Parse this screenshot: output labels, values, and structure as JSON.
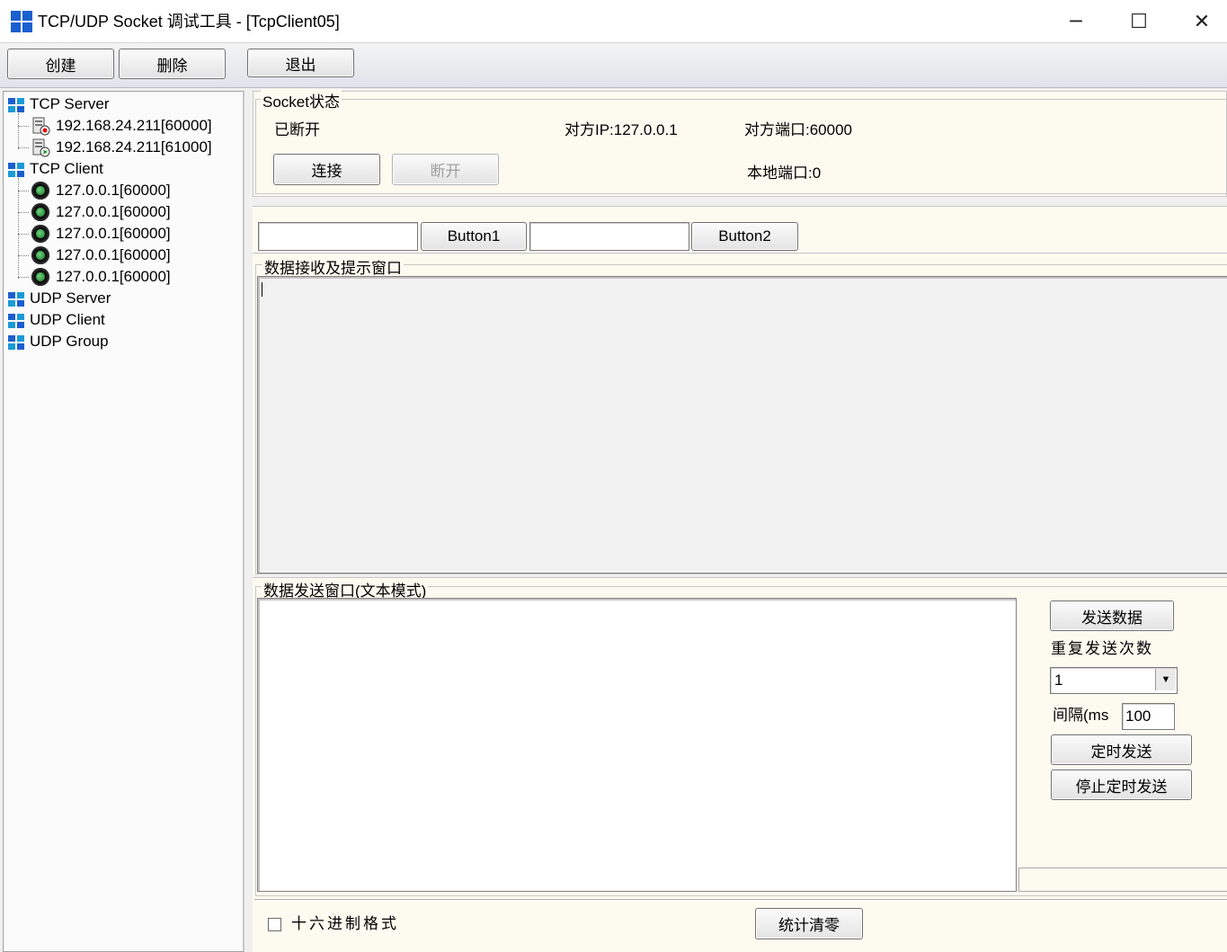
{
  "window": {
    "title": "TCP/UDP Socket 调试工具 - [TcpClient05]",
    "controls": {
      "minimize": "─",
      "maximize": "☐",
      "close": "✕"
    }
  },
  "toolbar": {
    "create": "创建",
    "delete": "删除",
    "exit": "退出"
  },
  "tree": {
    "tcp_server": {
      "label": "TCP Server",
      "children": [
        "192.168.24.211[60000]",
        "192.168.24.211[61000]"
      ]
    },
    "tcp_client": {
      "label": "TCP Client",
      "children": [
        "127.0.0.1[60000]",
        "127.0.0.1[60000]",
        "127.0.0.1[60000]",
        "127.0.0.1[60000]",
        "127.0.0.1[60000]"
      ]
    },
    "udp_server": {
      "label": "UDP Server"
    },
    "udp_client": {
      "label": "UDP Client"
    },
    "udp_group": {
      "label": "UDP Group"
    }
  },
  "socket_status": {
    "legend": "Socket状态",
    "state": "已断开",
    "peer_ip": "对方IP:127.0.0.1",
    "peer_port": "对方端口:60000",
    "local_port": "本地端口:0",
    "connect": "连接",
    "disconnect": "断开"
  },
  "tools": {
    "input1": "",
    "button1": "Button1",
    "input2": "",
    "button2": "Button2"
  },
  "receive": {
    "legend": "数据接收及提示窗口",
    "content": ""
  },
  "send": {
    "legend": "数据发送窗口(文本模式)",
    "content": "",
    "send_button": "发送数据",
    "repeat_label": "重复发送次数",
    "repeat_value": "1",
    "interval_label": "间隔(ms",
    "interval_value": "100",
    "timed_send": "定时发送",
    "stop_timed_send": "停止定时发送"
  },
  "bottom": {
    "hex_label": "十六进制格式",
    "hex_checked": false,
    "reset_stats": "统计清零"
  },
  "colors": {
    "panel_bg": "#fdfaf0",
    "accent_blue": "#1a5fd0",
    "client_green": "#1b7a2b"
  }
}
